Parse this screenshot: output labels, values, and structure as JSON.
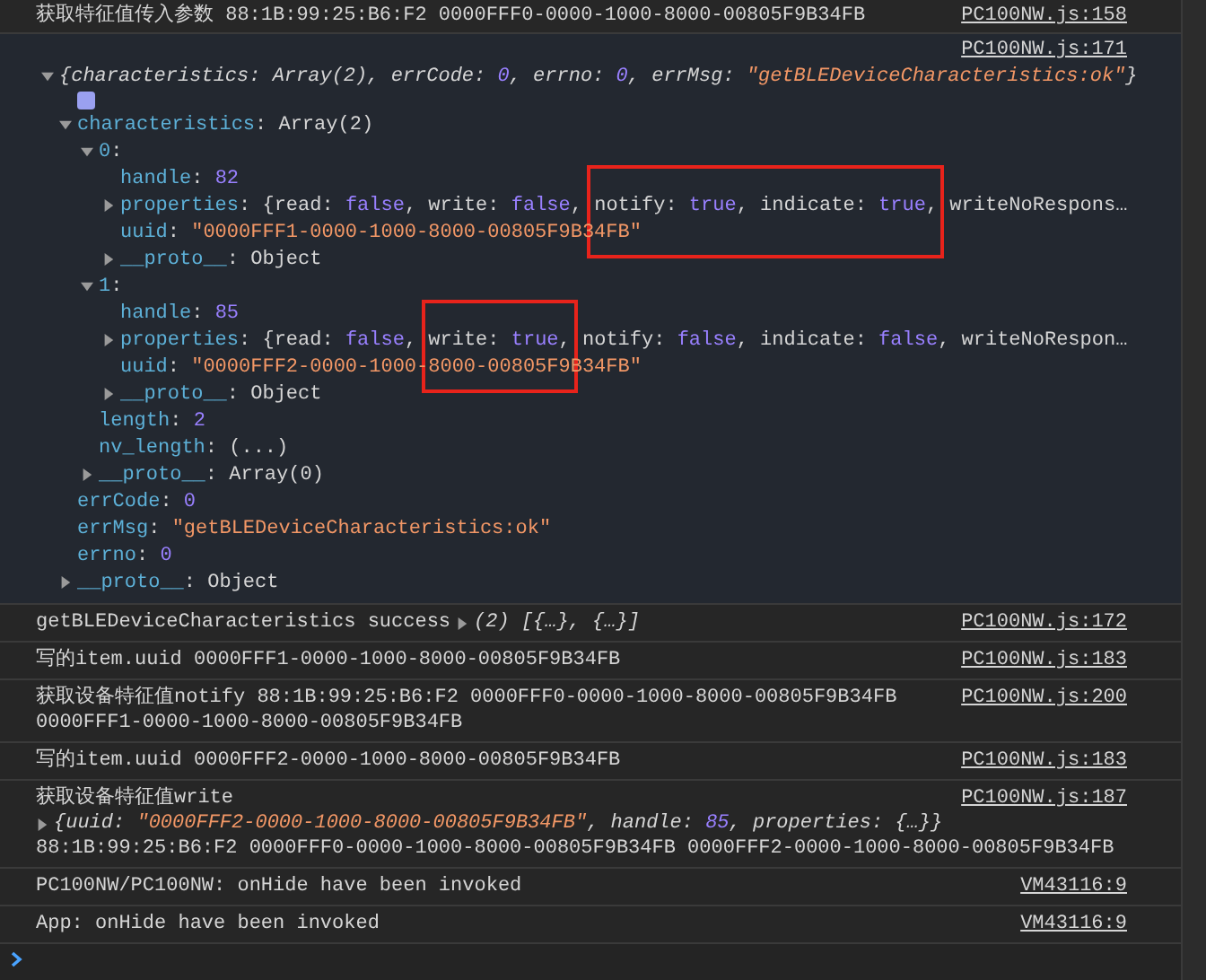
{
  "top_log": {
    "message": "获取特征值传入参数 88:1B:99:25:B6:F2 0000FFF0-0000-1000-8000-00805F9B34FB",
    "source": "PC100NW.js:158"
  },
  "object_log": {
    "source": "PC100NW.js:171",
    "expanded": true,
    "summary": [
      {
        "text": "{characteristics: Array(2), errCode: ",
        "kind": "text_i"
      },
      {
        "text": "0",
        "kind": "num_i"
      },
      {
        "text": ", errno: ",
        "kind": "text_i"
      },
      {
        "text": "0",
        "kind": "num_i"
      },
      {
        "text": ", errMsg: ",
        "kind": "text_i"
      },
      {
        "text": "\"getBLEDeviceCharacteristics:ok\"",
        "kind": "str_i"
      },
      {
        "text": "}",
        "kind": "text_i"
      }
    ],
    "children": [
      {
        "expanded": true,
        "tokens": [
          {
            "text": "characteristics",
            "kind": "key"
          },
          {
            "text": ": Array(2)",
            "kind": "text"
          }
        ],
        "children": [
          {
            "expanded": true,
            "tokens": [
              {
                "text": "0",
                "kind": "key"
              },
              {
                "text": ":",
                "kind": "text"
              }
            ],
            "children": [
              {
                "tokens": [
                  {
                    "text": "handle",
                    "kind": "key"
                  },
                  {
                    "text": ": ",
                    "kind": "text"
                  },
                  {
                    "text": "82",
                    "kind": "num"
                  }
                ]
              },
              {
                "expanded": false,
                "tokens": [
                  {
                    "text": "properties",
                    "kind": "key"
                  },
                  {
                    "text": ": {read: ",
                    "kind": "text"
                  },
                  {
                    "text": "false",
                    "kind": "num"
                  },
                  {
                    "text": ", write: ",
                    "kind": "text"
                  },
                  {
                    "text": "false",
                    "kind": "num"
                  },
                  {
                    "text": ", ",
                    "kind": "text"
                  }
                ],
                "boxed_tokens": [
                  {
                    "text": "notify: ",
                    "kind": "text"
                  },
                  {
                    "text": "true",
                    "kind": "num"
                  },
                  {
                    "text": ", indicate: ",
                    "kind": "text"
                  },
                  {
                    "text": "true",
                    "kind": "num"
                  },
                  {
                    "text": ",",
                    "kind": "text"
                  }
                ],
                "tail_tokens": [
                  {
                    "text": " writeNoRespons…",
                    "kind": "text"
                  }
                ]
              },
              {
                "tokens": [
                  {
                    "text": "uuid",
                    "kind": "key"
                  },
                  {
                    "text": ": ",
                    "kind": "text"
                  },
                  {
                    "text": "\"0000FFF1-0000-1000-8000-00805F9B34FB\"",
                    "kind": "str"
                  }
                ]
              },
              {
                "expanded": false,
                "tokens": [
                  {
                    "text": "__proto__",
                    "kind": "key"
                  },
                  {
                    "text": ": Object",
                    "kind": "text"
                  }
                ]
              }
            ]
          },
          {
            "expanded": true,
            "tokens": [
              {
                "text": "1",
                "kind": "key"
              },
              {
                "text": ":",
                "kind": "text"
              }
            ],
            "children": [
              {
                "tokens": [
                  {
                    "text": "handle",
                    "kind": "key"
                  },
                  {
                    "text": ": ",
                    "kind": "text"
                  },
                  {
                    "text": "85",
                    "kind": "num"
                  }
                ]
              },
              {
                "expanded": false,
                "tokens": [
                  {
                    "text": "properties",
                    "kind": "key"
                  },
                  {
                    "text": ": {read: ",
                    "kind": "text"
                  },
                  {
                    "text": "false",
                    "kind": "num"
                  },
                  {
                    "text": ", ",
                    "kind": "text"
                  }
                ],
                "boxed_tokens": [
                  {
                    "text": "write: ",
                    "kind": "text"
                  },
                  {
                    "text": "true",
                    "kind": "num"
                  },
                  {
                    "text": ",",
                    "kind": "text"
                  }
                ],
                "tail_tokens": [
                  {
                    "text": " notify: ",
                    "kind": "text"
                  },
                  {
                    "text": "false",
                    "kind": "num"
                  },
                  {
                    "text": ", indicate: ",
                    "kind": "text"
                  },
                  {
                    "text": "false",
                    "kind": "num"
                  },
                  {
                    "text": ", writeNoRespon…",
                    "kind": "text"
                  }
                ]
              },
              {
                "tokens": [
                  {
                    "text": "uuid",
                    "kind": "key"
                  },
                  {
                    "text": ": ",
                    "kind": "text"
                  },
                  {
                    "text": "\"0000FFF2-0000-1000-8000-00805F9B34FB\"",
                    "kind": "str"
                  }
                ]
              },
              {
                "expanded": false,
                "tokens": [
                  {
                    "text": "__proto__",
                    "kind": "key"
                  },
                  {
                    "text": ": Object",
                    "kind": "text"
                  }
                ]
              }
            ]
          },
          {
            "tokens": [
              {
                "text": "length",
                "kind": "key"
              },
              {
                "text": ": ",
                "kind": "text"
              },
              {
                "text": "2",
                "kind": "num"
              }
            ]
          },
          {
            "tokens": [
              {
                "text": "nv_length",
                "kind": "key"
              },
              {
                "text": ": (...)",
                "kind": "text"
              }
            ]
          },
          {
            "expanded": false,
            "tokens": [
              {
                "text": "__proto__",
                "kind": "key"
              },
              {
                "text": ": Array(0)",
                "kind": "text"
              }
            ]
          }
        ]
      },
      {
        "tokens": [
          {
            "text": "errCode",
            "kind": "key"
          },
          {
            "text": ": ",
            "kind": "text"
          },
          {
            "text": "0",
            "kind": "num"
          }
        ]
      },
      {
        "tokens": [
          {
            "text": "errMsg",
            "kind": "key"
          },
          {
            "text": ": ",
            "kind": "text"
          },
          {
            "text": "\"getBLEDeviceCharacteristics:ok\"",
            "kind": "str"
          }
        ]
      },
      {
        "tokens": [
          {
            "text": "errno",
            "kind": "key"
          },
          {
            "text": ": ",
            "kind": "text"
          },
          {
            "text": "0",
            "kind": "num"
          }
        ]
      },
      {
        "expanded": false,
        "tokens": [
          {
            "text": "__proto__",
            "kind": "key"
          },
          {
            "text": ": Object",
            "kind": "text"
          }
        ]
      }
    ]
  },
  "logs": [
    {
      "source": "PC100NW.js:172",
      "lines": [
        [
          {
            "text": "getBLEDeviceCharacteristics success",
            "kind": "text"
          },
          {
            "text": "(2) [{…}, {…}]",
            "kind": "text_i",
            "expanded": false
          }
        ]
      ]
    },
    {
      "source": "PC100NW.js:183",
      "lines": [
        [
          {
            "text": "写的item.uuid 0000FFF1-0000-1000-8000-00805F9B34FB",
            "kind": "text"
          }
        ]
      ]
    },
    {
      "source": "PC100NW.js:200",
      "lines": [
        [
          {
            "text": "获取设备特征值notify 88:1B:99:25:B6:F2 0000FFF0-0000-1000-8000-00805F9B34FB",
            "kind": "text"
          }
        ],
        [
          {
            "text": "0000FFF1-0000-1000-8000-00805F9B34FB",
            "kind": "text"
          }
        ]
      ]
    },
    {
      "source": "PC100NW.js:183",
      "lines": [
        [
          {
            "text": "写的item.uuid 0000FFF2-0000-1000-8000-00805F9B34FB",
            "kind": "text"
          }
        ]
      ]
    },
    {
      "source": "PC100NW.js:187",
      "lines": [
        [
          {
            "text": "获取设备特征值write",
            "kind": "text"
          }
        ],
        [
          {
            "text": "{uuid: ",
            "kind": "text_i",
            "expanded": false
          },
          {
            "text": "\"0000FFF2-0000-1000-8000-00805F9B34FB\"",
            "kind": "str_i"
          },
          {
            "text": ", handle: ",
            "kind": "text_i"
          },
          {
            "text": "85",
            "kind": "num_i"
          },
          {
            "text": ", properties: {…}}",
            "kind": "text_i"
          }
        ],
        [
          {
            "text": "88:1B:99:25:B6:F2 0000FFF0-0000-1000-8000-00805F9B34FB 0000FFF2-0000-1000-8000-00805F9B34FB",
            "kind": "text"
          }
        ]
      ]
    },
    {
      "source": "VM43116:9",
      "lines": [
        [
          {
            "text": "PC100NW/PC100NW: onHide have been invoked",
            "kind": "text"
          }
        ]
      ]
    },
    {
      "source": "VM43116:9",
      "lines": [
        [
          {
            "text": "App: onHide have been invoked",
            "kind": "text"
          }
        ]
      ]
    }
  ]
}
